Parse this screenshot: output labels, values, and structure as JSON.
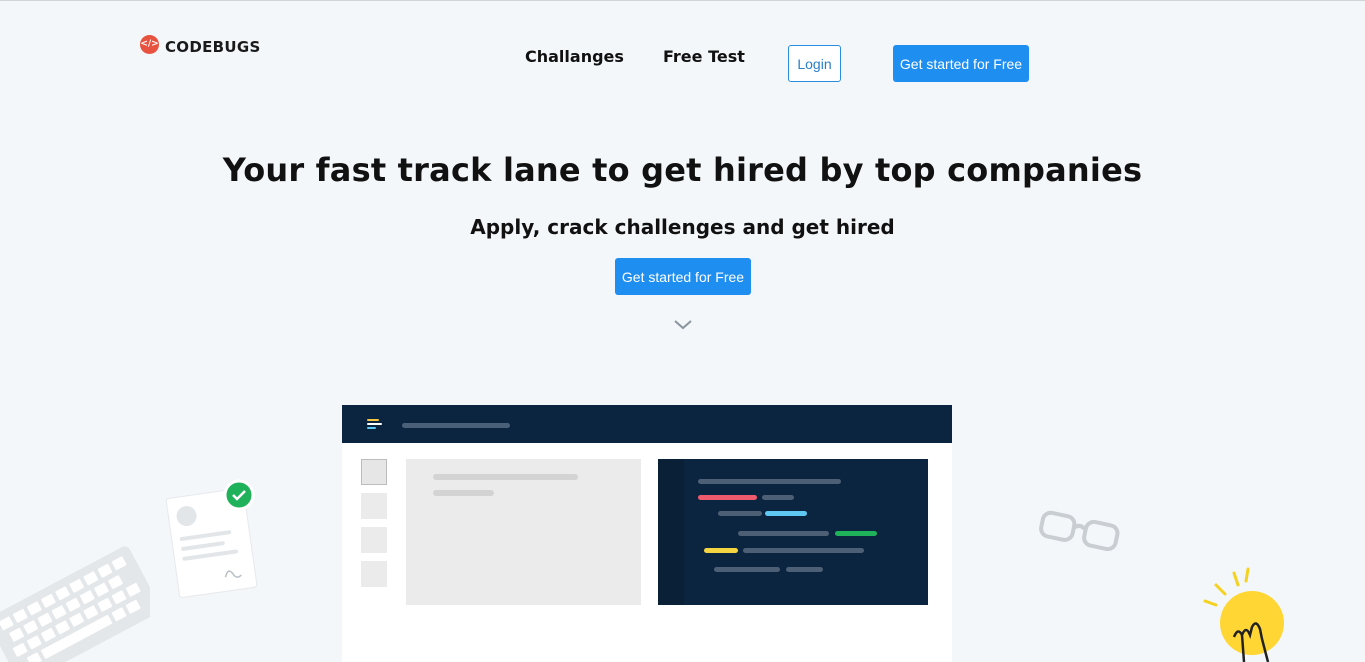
{
  "brand": {
    "name": "CODEBUGS",
    "icon": "code-icon",
    "icon_glyph": "</>",
    "color": "#e8533f"
  },
  "nav": {
    "challenges_label": "Challanges",
    "free_test_label": "Free Test",
    "login_label": "Login",
    "get_started_label": "Get started for Free"
  },
  "hero": {
    "title": "Your fast track lane to get hired by top companies",
    "subtitle": "Apply, crack challenges and get hired",
    "cta_label": "Get started for Free",
    "scroll_icon": "chevron-down-icon"
  },
  "colors": {
    "accent": "#1f8ef1",
    "background": "#f3f7fa",
    "mockup_dark": "#0b2540",
    "success": "#1fb25a",
    "bulb": "#ffd633"
  },
  "illustrations": [
    "keyboard-illustration",
    "resume-document-illustration",
    "glasses-illustration",
    "lightbulb-illustration",
    "app-mockup-illustration"
  ]
}
